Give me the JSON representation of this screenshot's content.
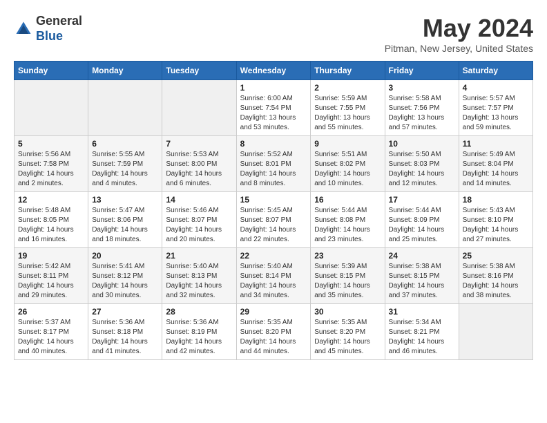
{
  "header": {
    "logo_general": "General",
    "logo_blue": "Blue",
    "month_title": "May 2024",
    "location": "Pitman, New Jersey, United States"
  },
  "weekdays": [
    "Sunday",
    "Monday",
    "Tuesday",
    "Wednesday",
    "Thursday",
    "Friday",
    "Saturday"
  ],
  "weeks": [
    [
      {
        "day": "",
        "info": ""
      },
      {
        "day": "",
        "info": ""
      },
      {
        "day": "",
        "info": ""
      },
      {
        "day": "1",
        "info": "Sunrise: 6:00 AM\nSunset: 7:54 PM\nDaylight: 13 hours\nand 53 minutes."
      },
      {
        "day": "2",
        "info": "Sunrise: 5:59 AM\nSunset: 7:55 PM\nDaylight: 13 hours\nand 55 minutes."
      },
      {
        "day": "3",
        "info": "Sunrise: 5:58 AM\nSunset: 7:56 PM\nDaylight: 13 hours\nand 57 minutes."
      },
      {
        "day": "4",
        "info": "Sunrise: 5:57 AM\nSunset: 7:57 PM\nDaylight: 13 hours\nand 59 minutes."
      }
    ],
    [
      {
        "day": "5",
        "info": "Sunrise: 5:56 AM\nSunset: 7:58 PM\nDaylight: 14 hours\nand 2 minutes."
      },
      {
        "day": "6",
        "info": "Sunrise: 5:55 AM\nSunset: 7:59 PM\nDaylight: 14 hours\nand 4 minutes."
      },
      {
        "day": "7",
        "info": "Sunrise: 5:53 AM\nSunset: 8:00 PM\nDaylight: 14 hours\nand 6 minutes."
      },
      {
        "day": "8",
        "info": "Sunrise: 5:52 AM\nSunset: 8:01 PM\nDaylight: 14 hours\nand 8 minutes."
      },
      {
        "day": "9",
        "info": "Sunrise: 5:51 AM\nSunset: 8:02 PM\nDaylight: 14 hours\nand 10 minutes."
      },
      {
        "day": "10",
        "info": "Sunrise: 5:50 AM\nSunset: 8:03 PM\nDaylight: 14 hours\nand 12 minutes."
      },
      {
        "day": "11",
        "info": "Sunrise: 5:49 AM\nSunset: 8:04 PM\nDaylight: 14 hours\nand 14 minutes."
      }
    ],
    [
      {
        "day": "12",
        "info": "Sunrise: 5:48 AM\nSunset: 8:05 PM\nDaylight: 14 hours\nand 16 minutes."
      },
      {
        "day": "13",
        "info": "Sunrise: 5:47 AM\nSunset: 8:06 PM\nDaylight: 14 hours\nand 18 minutes."
      },
      {
        "day": "14",
        "info": "Sunrise: 5:46 AM\nSunset: 8:07 PM\nDaylight: 14 hours\nand 20 minutes."
      },
      {
        "day": "15",
        "info": "Sunrise: 5:45 AM\nSunset: 8:07 PM\nDaylight: 14 hours\nand 22 minutes."
      },
      {
        "day": "16",
        "info": "Sunrise: 5:44 AM\nSunset: 8:08 PM\nDaylight: 14 hours\nand 23 minutes."
      },
      {
        "day": "17",
        "info": "Sunrise: 5:44 AM\nSunset: 8:09 PM\nDaylight: 14 hours\nand 25 minutes."
      },
      {
        "day": "18",
        "info": "Sunrise: 5:43 AM\nSunset: 8:10 PM\nDaylight: 14 hours\nand 27 minutes."
      }
    ],
    [
      {
        "day": "19",
        "info": "Sunrise: 5:42 AM\nSunset: 8:11 PM\nDaylight: 14 hours\nand 29 minutes."
      },
      {
        "day": "20",
        "info": "Sunrise: 5:41 AM\nSunset: 8:12 PM\nDaylight: 14 hours\nand 30 minutes."
      },
      {
        "day": "21",
        "info": "Sunrise: 5:40 AM\nSunset: 8:13 PM\nDaylight: 14 hours\nand 32 minutes."
      },
      {
        "day": "22",
        "info": "Sunrise: 5:40 AM\nSunset: 8:14 PM\nDaylight: 14 hours\nand 34 minutes."
      },
      {
        "day": "23",
        "info": "Sunrise: 5:39 AM\nSunset: 8:15 PM\nDaylight: 14 hours\nand 35 minutes."
      },
      {
        "day": "24",
        "info": "Sunrise: 5:38 AM\nSunset: 8:15 PM\nDaylight: 14 hours\nand 37 minutes."
      },
      {
        "day": "25",
        "info": "Sunrise: 5:38 AM\nSunset: 8:16 PM\nDaylight: 14 hours\nand 38 minutes."
      }
    ],
    [
      {
        "day": "26",
        "info": "Sunrise: 5:37 AM\nSunset: 8:17 PM\nDaylight: 14 hours\nand 40 minutes."
      },
      {
        "day": "27",
        "info": "Sunrise: 5:36 AM\nSunset: 8:18 PM\nDaylight: 14 hours\nand 41 minutes."
      },
      {
        "day": "28",
        "info": "Sunrise: 5:36 AM\nSunset: 8:19 PM\nDaylight: 14 hours\nand 42 minutes."
      },
      {
        "day": "29",
        "info": "Sunrise: 5:35 AM\nSunset: 8:20 PM\nDaylight: 14 hours\nand 44 minutes."
      },
      {
        "day": "30",
        "info": "Sunrise: 5:35 AM\nSunset: 8:20 PM\nDaylight: 14 hours\nand 45 minutes."
      },
      {
        "day": "31",
        "info": "Sunrise: 5:34 AM\nSunset: 8:21 PM\nDaylight: 14 hours\nand 46 minutes."
      },
      {
        "day": "",
        "info": ""
      }
    ]
  ]
}
